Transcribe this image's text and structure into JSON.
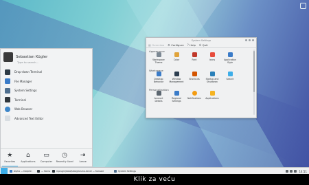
{
  "launcher": {
    "user_name": "Sebastian Kügler",
    "search_placeholder": "Type to search...",
    "favorites": [
      {
        "label": "Drop-down Terminal",
        "icon": "terminal-icon",
        "color": "#2d3a45"
      },
      {
        "label": "File Manager",
        "icon": "folder-icon",
        "color": "#3a7bc8"
      },
      {
        "label": "System Settings",
        "icon": "settings-icon",
        "color": "#4f6f8f"
      },
      {
        "label": "Terminal",
        "icon": "terminal-icon",
        "color": "#30363c"
      },
      {
        "label": "Web Browser",
        "icon": "globe-icon",
        "color": "#3d86c9"
      },
      {
        "label": "Advanced Text Editor",
        "icon": "text-editor-icon",
        "color": "#d8dde2"
      }
    ],
    "tabs": [
      {
        "label": "Favorites",
        "icon": "star-icon",
        "glyph": "★"
      },
      {
        "label": "Applications",
        "icon": "applications-icon",
        "glyph": "⌂"
      },
      {
        "label": "Computer",
        "icon": "computer-icon",
        "glyph": "▭"
      },
      {
        "label": "Recently Used",
        "icon": "clock-icon",
        "glyph": "◷"
      },
      {
        "label": "Leave",
        "icon": "leave-icon",
        "glyph": "⇥"
      }
    ]
  },
  "settings_window": {
    "title": "System Settings",
    "toolbar": [
      {
        "label": "Overview",
        "icon": "overview-icon",
        "glyph": "▦",
        "enabled": false
      },
      {
        "label": "Configure",
        "icon": "configure-icon",
        "glyph": "⚙",
        "enabled": true
      },
      {
        "label": "Help",
        "icon": "help-icon",
        "glyph": "?",
        "enabled": true
      },
      {
        "label": "Quit",
        "icon": "quit-icon",
        "glyph": "⏻",
        "enabled": true
      }
    ],
    "sections": [
      {
        "title": "Appearance",
        "items": [
          {
            "label": "Workspace Theme",
            "icon": "theme-icon",
            "color": "#7c8893"
          },
          {
            "label": "Color",
            "icon": "color-icon",
            "color": "#e0a33a"
          },
          {
            "label": "Font",
            "icon": "font-icon",
            "color": "#c0392b"
          },
          {
            "label": "Icons",
            "icon": "icons-icon",
            "color": "#e74c3c"
          },
          {
            "label": "Application Style",
            "icon": "style-icon",
            "color": "#3a7bc8"
          }
        ]
      },
      {
        "title": "Workspace",
        "items": [
          {
            "label": "Desktop Behavior",
            "icon": "desktop-icon",
            "color": "#3a7bc8"
          },
          {
            "label": "Window Management",
            "icon": "window-icon",
            "color": "#2c3e50"
          },
          {
            "label": "Shortcuts",
            "icon": "shortcuts-icon",
            "color": "#d35400"
          },
          {
            "label": "Startup and Shutdown",
            "icon": "startup-icon",
            "color": "#2980b9"
          },
          {
            "label": "Search",
            "icon": "search-icon",
            "color": "#3daee9"
          }
        ]
      },
      {
        "title": "Personalization",
        "items": [
          {
            "label": "Account Details",
            "icon": "account-icon",
            "color": "#5b6670"
          },
          {
            "label": "Regional Settings",
            "icon": "regional-icon",
            "color": "#3a7bc8"
          },
          {
            "label": "Notifications",
            "icon": "notifications-icon",
            "color": "#f39c12"
          },
          {
            "label": "Applications",
            "icon": "applications-star-icon",
            "color": "#f5b321"
          }
        ]
      }
    ]
  },
  "taskbar": {
    "tasks": [
      {
        "label": "Alpha — Dolphin",
        "color": "#3a7bc8"
      },
      {
        "label": " — Konsole",
        "color": "#30363c"
      },
      {
        "label": "mplugin/data/tabs/plasma-devel — Konsole",
        "color": "#30363c"
      },
      {
        "label": "System Settings",
        "color": "#4f6f8f"
      }
    ],
    "clock": "14:51"
  },
  "caption": {
    "text": "Klik za veću"
  }
}
